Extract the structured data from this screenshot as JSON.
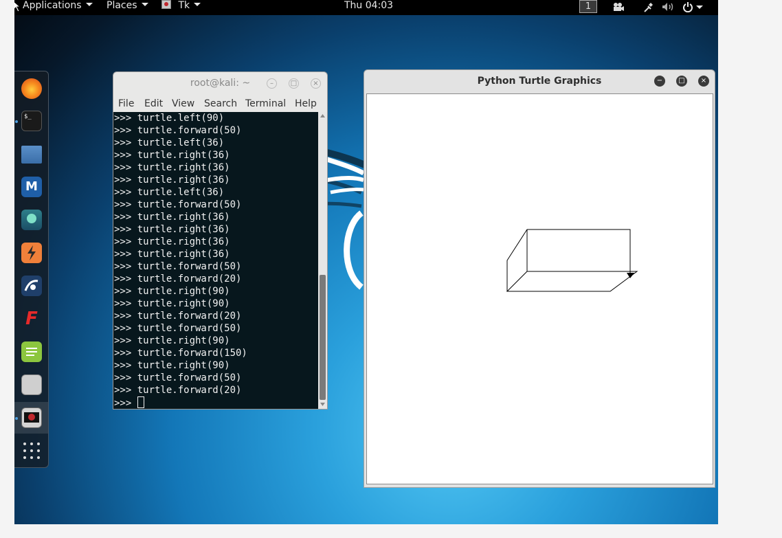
{
  "topbar": {
    "applications": "Applications",
    "places": "Places",
    "active_app": "Tk",
    "clock": "Thu 04:03",
    "workspace": "1"
  },
  "dock": {
    "apps": [
      "firefox-icon",
      "terminal-icon",
      "files-icon",
      "metasploit-icon",
      "armitage-icon",
      "burpsuite-icon",
      "beef-icon",
      "faraday-icon",
      "leafpad-icon",
      "cutycapt-icon",
      "tk-app-icon",
      "show-apps-icon"
    ]
  },
  "terminal": {
    "title": "root@kali: ~",
    "menu": [
      "File",
      "Edit",
      "View",
      "Search",
      "Terminal",
      "Help"
    ],
    "lines": [
      ">>> turtle.left(90)",
      ">>> turtle.forward(50)",
      ">>> turtle.left(36)",
      ">>> turtle.right(36)",
      ">>> turtle.right(36)",
      ">>> turtle.right(36)",
      ">>> turtle.left(36)",
      ">>> turtle.forward(50)",
      ">>> turtle.right(36)",
      ">>> turtle.right(36)",
      ">>> turtle.right(36)",
      ">>> turtle.right(36)",
      ">>> turtle.forward(50)",
      ">>> turtle.forward(20)",
      ">>> turtle.right(90)",
      ">>> turtle.right(90)",
      ">>> turtle.forward(20)",
      ">>> turtle.forward(50)",
      ">>> turtle.right(90)",
      ">>> turtle.forward(150)",
      ">>> turtle.right(90)",
      ">>> turtle.forward(50)",
      ">>> turtle.forward(20)"
    ],
    "prompt": ">>> "
  },
  "turtle_window": {
    "title": "Python Turtle Graphics"
  },
  "colors": {
    "topbar": "#000000",
    "terminal_bg": "#07171d",
    "accent": "#4d9fe0"
  }
}
